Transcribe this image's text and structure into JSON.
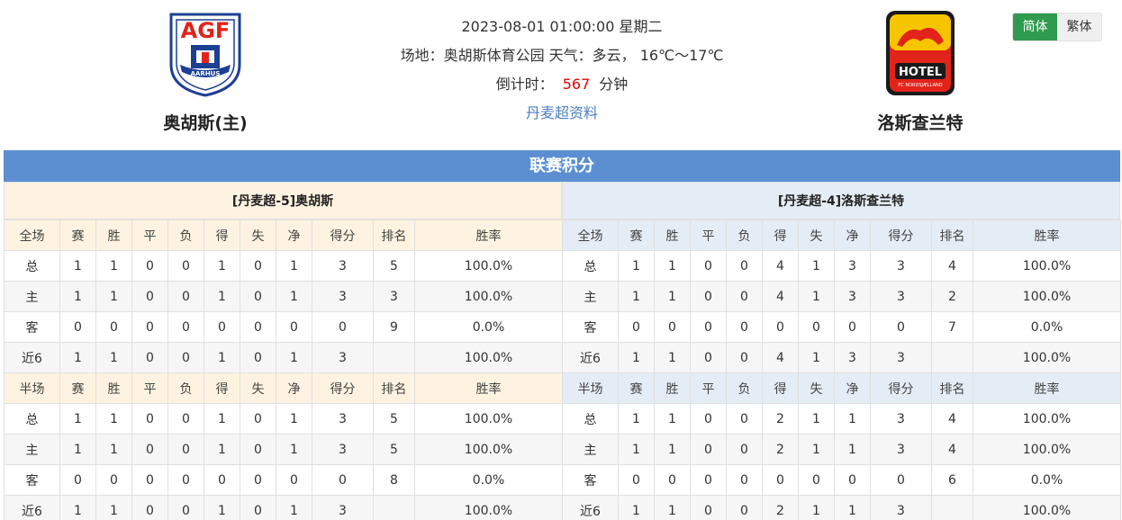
{
  "match": {
    "datetime": "2023-08-01 01:00:00 星期二",
    "venue_line": "场地：奥胡斯体育公园 天气：多云， 16℃～17℃",
    "countdown_label": "倒计时：",
    "countdown_value": "567",
    "countdown_unit": "分钟",
    "league_link": "丹麦超资料"
  },
  "home_team": {
    "name": "奥胡斯(主)",
    "logo_text": "AGF",
    "logo_sub": "AARHUS"
  },
  "away_team": {
    "name": "洛斯查兰特",
    "logo_text": "HOTEL",
    "logo_sub": "FC NORDSJÆLLAND"
  },
  "lang": {
    "simplified": "简体",
    "traditional": "繁体"
  },
  "section_title": "联赛积分",
  "colors": {
    "accent": "#5b8fd1",
    "home_tint": "#fdf3e0",
    "away_tint": "#e4ecf5",
    "active_lang": "#2e9b4f",
    "home_label": "#e60000",
    "away_label": "#1a3fb8"
  },
  "home_panel": {
    "title": "[丹麦超-5]奥胡斯",
    "full_header": [
      "全场",
      "赛",
      "胜",
      "平",
      "负",
      "得",
      "失",
      "净",
      "得分",
      "排名",
      "胜率"
    ],
    "full_rows": [
      [
        "总",
        "1",
        "1",
        "0",
        "0",
        "1",
        "0",
        "1",
        "3",
        "5",
        "100.0%"
      ],
      [
        "主",
        "1",
        "1",
        "0",
        "0",
        "1",
        "0",
        "1",
        "3",
        "3",
        "100.0%"
      ],
      [
        "客",
        "0",
        "0",
        "0",
        "0",
        "0",
        "0",
        "0",
        "0",
        "9",
        "0.0%"
      ],
      [
        "近6",
        "1",
        "1",
        "0",
        "0",
        "1",
        "0",
        "1",
        "3",
        "",
        "100.0%"
      ]
    ],
    "half_header": [
      "半场",
      "赛",
      "胜",
      "平",
      "负",
      "得",
      "失",
      "净",
      "得分",
      "排名",
      "胜率"
    ],
    "half_rows": [
      [
        "总",
        "1",
        "1",
        "0",
        "0",
        "1",
        "0",
        "1",
        "3",
        "5",
        "100.0%"
      ],
      [
        "主",
        "1",
        "1",
        "0",
        "0",
        "1",
        "0",
        "1",
        "3",
        "5",
        "100.0%"
      ],
      [
        "客",
        "0",
        "0",
        "0",
        "0",
        "0",
        "0",
        "0",
        "0",
        "8",
        "0.0%"
      ],
      [
        "近6",
        "1",
        "1",
        "0",
        "0",
        "1",
        "0",
        "1",
        "3",
        "",
        "100.0%"
      ]
    ]
  },
  "away_panel": {
    "title": "[丹麦超-4]洛斯查兰特",
    "full_header": [
      "全场",
      "赛",
      "胜",
      "平",
      "负",
      "得",
      "失",
      "净",
      "得分",
      "排名",
      "胜率"
    ],
    "full_rows": [
      [
        "总",
        "1",
        "1",
        "0",
        "0",
        "4",
        "1",
        "3",
        "3",
        "4",
        "100.0%"
      ],
      [
        "主",
        "1",
        "1",
        "0",
        "0",
        "4",
        "1",
        "3",
        "3",
        "2",
        "100.0%"
      ],
      [
        "客",
        "0",
        "0",
        "0",
        "0",
        "0",
        "0",
        "0",
        "0",
        "7",
        "0.0%"
      ],
      [
        "近6",
        "1",
        "1",
        "0",
        "0",
        "4",
        "1",
        "3",
        "3",
        "",
        "100.0%"
      ]
    ],
    "half_header": [
      "半场",
      "赛",
      "胜",
      "平",
      "负",
      "得",
      "失",
      "净",
      "得分",
      "排名",
      "胜率"
    ],
    "half_rows": [
      [
        "总",
        "1",
        "1",
        "0",
        "0",
        "2",
        "1",
        "1",
        "3",
        "4",
        "100.0%"
      ],
      [
        "主",
        "1",
        "1",
        "0",
        "0",
        "2",
        "1",
        "1",
        "3",
        "4",
        "100.0%"
      ],
      [
        "客",
        "0",
        "0",
        "0",
        "0",
        "0",
        "0",
        "0",
        "0",
        "6",
        "0.0%"
      ],
      [
        "近6",
        "1",
        "1",
        "0",
        "0",
        "2",
        "1",
        "1",
        "3",
        "",
        "100.0%"
      ]
    ]
  }
}
